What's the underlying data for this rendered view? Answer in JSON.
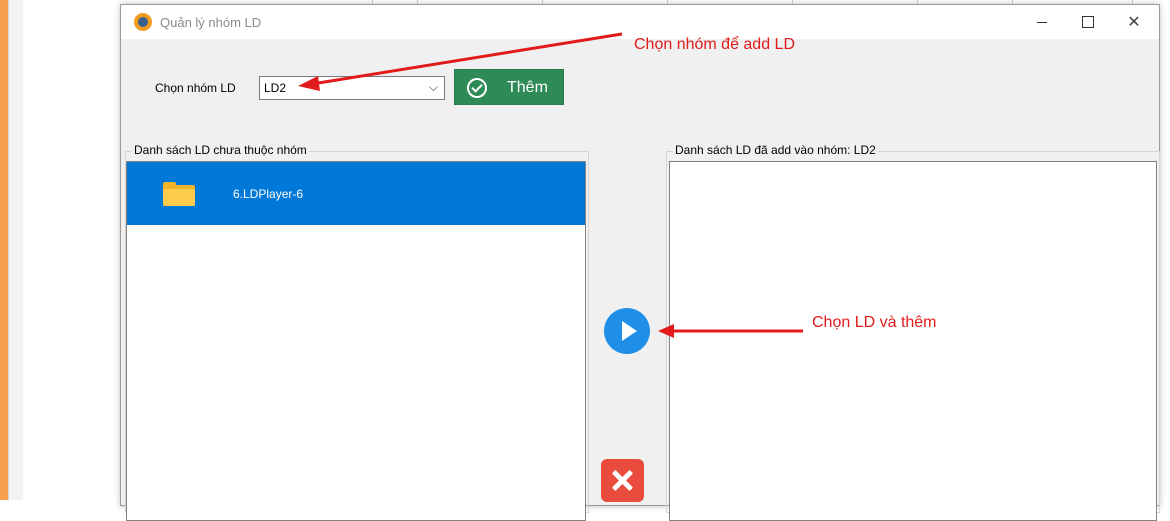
{
  "window": {
    "title": "Quản lý nhóm LD",
    "controls": {
      "minimize": "minimize",
      "maximize": "maximize",
      "close": "✕"
    }
  },
  "group_selector": {
    "label": "Chọn nhóm LD",
    "selected": "LD2",
    "add_button_label": "Thêm"
  },
  "left_panel": {
    "title": "Danh sách LD chưa thuộc nhóm",
    "items": [
      {
        "label": "6.LDPlayer-6",
        "icon": "folder-icon",
        "selected": true
      }
    ]
  },
  "right_panel": {
    "title": "Danh sách LD đã add vào nhóm: LD2",
    "items": []
  },
  "annotations": {
    "choose_group": "Chọn nhóm để add LD",
    "choose_ld": "Chọn LD và thêm"
  },
  "colors": {
    "selection": "#0078d7",
    "add_button": "#2e8b57",
    "move_button": "#1f8ee6",
    "remove_button": "#e94b3c",
    "annotation": "#e11b1b"
  }
}
